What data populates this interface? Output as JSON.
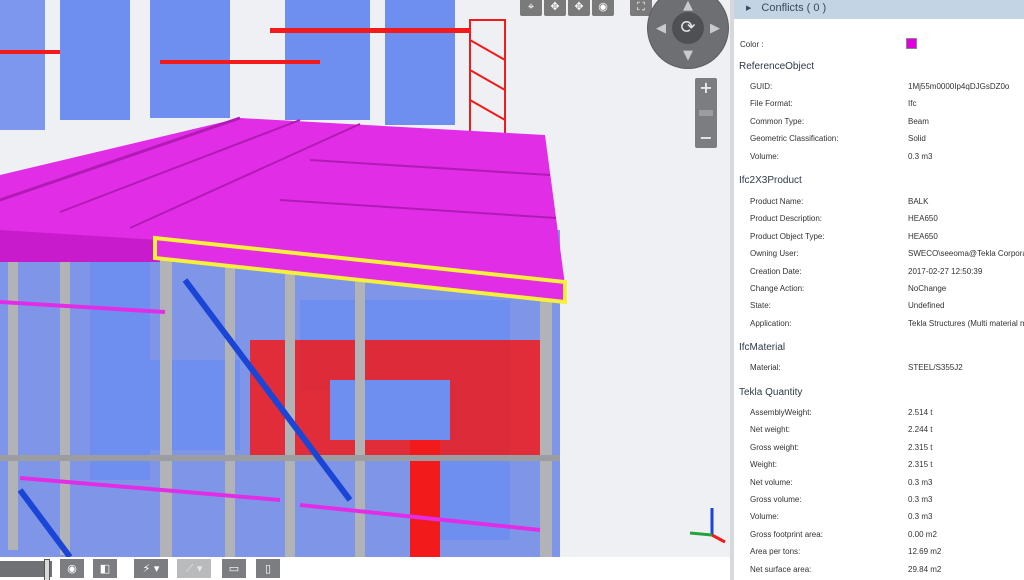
{
  "panel": {
    "conflicts_label": "Conflicts ( 0 )",
    "color_label": "Color :",
    "color_value": "#e000e0",
    "groups": [
      {
        "title": "ReferenceObject",
        "props": [
          {
            "key": "GUID:",
            "value": "1Mj55m0000Ip4qDJGsDZ0o"
          },
          {
            "key": "File Format:",
            "value": "Ifc"
          },
          {
            "key": "Common Type:",
            "value": "Beam"
          },
          {
            "key": "Geometric Classification:",
            "value": "Solid"
          },
          {
            "key": "Volume:",
            "value": "0.3 m3"
          }
        ]
      },
      {
        "title": "Ifc2X3Product",
        "props": [
          {
            "key": "Product Name:",
            "value": "BALK"
          },
          {
            "key": "Product Description:",
            "value": "HEA650"
          },
          {
            "key": "Product Object Type:",
            "value": "HEA650"
          },
          {
            "key": "Owning User:",
            "value": "SWECO\\seeoma@Tekla Corporat"
          },
          {
            "key": "Creation Date:",
            "value": "2017-02-27 12:50:39"
          },
          {
            "key": "Change Action:",
            "value": "NoChange"
          },
          {
            "key": "State:",
            "value": "Undefined"
          },
          {
            "key": "Application:",
            "value": "Tekla Structures (Multi material m"
          }
        ]
      },
      {
        "title": "IfcMaterial",
        "props": [
          {
            "key": "Material:",
            "value": "STEEL/S355J2"
          }
        ]
      },
      {
        "title": "Tekla Quantity",
        "props": [
          {
            "key": "AssemblyWeight:",
            "value": "2.514 t"
          },
          {
            "key": "Net weight:",
            "value": "2.244 t"
          },
          {
            "key": "Gross weight:",
            "value": "2.315 t"
          },
          {
            "key": "Weight:",
            "value": "2.315 t"
          },
          {
            "key": "Net volume:",
            "value": "0.3 m3"
          },
          {
            "key": "Gross volume:",
            "value": "0.3 m3"
          },
          {
            "key": "Volume:",
            "value": "0.3 m3"
          },
          {
            "key": "Gross footprint area:",
            "value": "0.00 m2"
          },
          {
            "key": "Area per tons:",
            "value": "12.69 m2"
          },
          {
            "key": "Net surface area:",
            "value": "29.84 m2"
          }
        ]
      }
    ]
  },
  "viewer": {
    "top_tools": [
      {
        "name": "select-icon",
        "glyph": "⌖"
      },
      {
        "name": "pan-icon",
        "glyph": "✥"
      },
      {
        "name": "move-icon",
        "glyph": "✥"
      },
      {
        "name": "look-icon",
        "glyph": "◉"
      },
      {
        "name": "fullscreen-icon",
        "glyph": "⛶"
      }
    ],
    "nav_wheel_icon": "rotate-icon",
    "zoom_in": "+",
    "zoom_out": "−",
    "colors": {
      "structure": "#6e8ef0",
      "selected_beams": "#e12ee6",
      "highlight": "#f5f03a",
      "clash": "#f21a1a",
      "columns": "#b2b3b7"
    }
  },
  "bottom_toolbar": [
    {
      "name": "visibility-icon",
      "glyph": "◉",
      "disabled": false
    },
    {
      "name": "section-box-icon",
      "glyph": "◧",
      "disabled": false
    },
    {
      "name": "lightning-icon",
      "glyph": "⚡ ▾",
      "disabled": false
    },
    {
      "name": "measure-icon",
      "glyph": "⟋ ▾",
      "disabled": true
    },
    {
      "name": "comment-icon",
      "glyph": "▭",
      "disabled": false
    },
    {
      "name": "document-icon",
      "glyph": "▯",
      "disabled": false
    }
  ]
}
